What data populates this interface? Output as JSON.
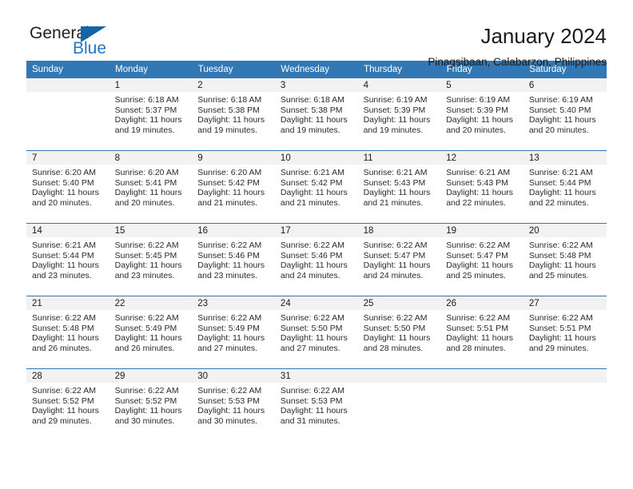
{
  "logo": {
    "word1": "General",
    "word2": "Blue",
    "triangle_color": "#1464aa",
    "blue_color": "#1e78c8"
  },
  "header": {
    "title": "January 2024",
    "subtitle": "Pinagsibaan, Calabarzon, Philippines"
  },
  "theme": {
    "header_bg": "#3278b4",
    "daynum_bg": "#f2f2f2",
    "grid_line": "#3278b4"
  },
  "weekdays": [
    "Sunday",
    "Monday",
    "Tuesday",
    "Wednesday",
    "Thursday",
    "Friday",
    "Saturday"
  ],
  "labels": {
    "sunrise_prefix": "Sunrise: ",
    "sunset_prefix": "Sunset: ",
    "daylight_prefix": "Daylight: "
  },
  "weeks": [
    [
      {
        "day": "",
        "blank": true
      },
      {
        "day": "1",
        "sunrise": "Sunrise: 6:18 AM",
        "sunset": "Sunset: 5:37 PM",
        "daylight1": "Daylight: 11 hours",
        "daylight2": "and 19 minutes."
      },
      {
        "day": "2",
        "sunrise": "Sunrise: 6:18 AM",
        "sunset": "Sunset: 5:38 PM",
        "daylight1": "Daylight: 11 hours",
        "daylight2": "and 19 minutes."
      },
      {
        "day": "3",
        "sunrise": "Sunrise: 6:18 AM",
        "sunset": "Sunset: 5:38 PM",
        "daylight1": "Daylight: 11 hours",
        "daylight2": "and 19 minutes."
      },
      {
        "day": "4",
        "sunrise": "Sunrise: 6:19 AM",
        "sunset": "Sunset: 5:39 PM",
        "daylight1": "Daylight: 11 hours",
        "daylight2": "and 19 minutes."
      },
      {
        "day": "5",
        "sunrise": "Sunrise: 6:19 AM",
        "sunset": "Sunset: 5:39 PM",
        "daylight1": "Daylight: 11 hours",
        "daylight2": "and 20 minutes."
      },
      {
        "day": "6",
        "sunrise": "Sunrise: 6:19 AM",
        "sunset": "Sunset: 5:40 PM",
        "daylight1": "Daylight: 11 hours",
        "daylight2": "and 20 minutes."
      }
    ],
    [
      {
        "day": "7",
        "sunrise": "Sunrise: 6:20 AM",
        "sunset": "Sunset: 5:40 PM",
        "daylight1": "Daylight: 11 hours",
        "daylight2": "and 20 minutes."
      },
      {
        "day": "8",
        "sunrise": "Sunrise: 6:20 AM",
        "sunset": "Sunset: 5:41 PM",
        "daylight1": "Daylight: 11 hours",
        "daylight2": "and 20 minutes."
      },
      {
        "day": "9",
        "sunrise": "Sunrise: 6:20 AM",
        "sunset": "Sunset: 5:42 PM",
        "daylight1": "Daylight: 11 hours",
        "daylight2": "and 21 minutes."
      },
      {
        "day": "10",
        "sunrise": "Sunrise: 6:21 AM",
        "sunset": "Sunset: 5:42 PM",
        "daylight1": "Daylight: 11 hours",
        "daylight2": "and 21 minutes."
      },
      {
        "day": "11",
        "sunrise": "Sunrise: 6:21 AM",
        "sunset": "Sunset: 5:43 PM",
        "daylight1": "Daylight: 11 hours",
        "daylight2": "and 21 minutes."
      },
      {
        "day": "12",
        "sunrise": "Sunrise: 6:21 AM",
        "sunset": "Sunset: 5:43 PM",
        "daylight1": "Daylight: 11 hours",
        "daylight2": "and 22 minutes."
      },
      {
        "day": "13",
        "sunrise": "Sunrise: 6:21 AM",
        "sunset": "Sunset: 5:44 PM",
        "daylight1": "Daylight: 11 hours",
        "daylight2": "and 22 minutes."
      }
    ],
    [
      {
        "day": "14",
        "sunrise": "Sunrise: 6:21 AM",
        "sunset": "Sunset: 5:44 PM",
        "daylight1": "Daylight: 11 hours",
        "daylight2": "and 23 minutes."
      },
      {
        "day": "15",
        "sunrise": "Sunrise: 6:22 AM",
        "sunset": "Sunset: 5:45 PM",
        "daylight1": "Daylight: 11 hours",
        "daylight2": "and 23 minutes."
      },
      {
        "day": "16",
        "sunrise": "Sunrise: 6:22 AM",
        "sunset": "Sunset: 5:46 PM",
        "daylight1": "Daylight: 11 hours",
        "daylight2": "and 23 minutes."
      },
      {
        "day": "17",
        "sunrise": "Sunrise: 6:22 AM",
        "sunset": "Sunset: 5:46 PM",
        "daylight1": "Daylight: 11 hours",
        "daylight2": "and 24 minutes."
      },
      {
        "day": "18",
        "sunrise": "Sunrise: 6:22 AM",
        "sunset": "Sunset: 5:47 PM",
        "daylight1": "Daylight: 11 hours",
        "daylight2": "and 24 minutes."
      },
      {
        "day": "19",
        "sunrise": "Sunrise: 6:22 AM",
        "sunset": "Sunset: 5:47 PM",
        "daylight1": "Daylight: 11 hours",
        "daylight2": "and 25 minutes."
      },
      {
        "day": "20",
        "sunrise": "Sunrise: 6:22 AM",
        "sunset": "Sunset: 5:48 PM",
        "daylight1": "Daylight: 11 hours",
        "daylight2": "and 25 minutes."
      }
    ],
    [
      {
        "day": "21",
        "sunrise": "Sunrise: 6:22 AM",
        "sunset": "Sunset: 5:48 PM",
        "daylight1": "Daylight: 11 hours",
        "daylight2": "and 26 minutes."
      },
      {
        "day": "22",
        "sunrise": "Sunrise: 6:22 AM",
        "sunset": "Sunset: 5:49 PM",
        "daylight1": "Daylight: 11 hours",
        "daylight2": "and 26 minutes."
      },
      {
        "day": "23",
        "sunrise": "Sunrise: 6:22 AM",
        "sunset": "Sunset: 5:49 PM",
        "daylight1": "Daylight: 11 hours",
        "daylight2": "and 27 minutes."
      },
      {
        "day": "24",
        "sunrise": "Sunrise: 6:22 AM",
        "sunset": "Sunset: 5:50 PM",
        "daylight1": "Daylight: 11 hours",
        "daylight2": "and 27 minutes."
      },
      {
        "day": "25",
        "sunrise": "Sunrise: 6:22 AM",
        "sunset": "Sunset: 5:50 PM",
        "daylight1": "Daylight: 11 hours",
        "daylight2": "and 28 minutes."
      },
      {
        "day": "26",
        "sunrise": "Sunrise: 6:22 AM",
        "sunset": "Sunset: 5:51 PM",
        "daylight1": "Daylight: 11 hours",
        "daylight2": "and 28 minutes."
      },
      {
        "day": "27",
        "sunrise": "Sunrise: 6:22 AM",
        "sunset": "Sunset: 5:51 PM",
        "daylight1": "Daylight: 11 hours",
        "daylight2": "and 29 minutes."
      }
    ],
    [
      {
        "day": "28",
        "sunrise": "Sunrise: 6:22 AM",
        "sunset": "Sunset: 5:52 PM",
        "daylight1": "Daylight: 11 hours",
        "daylight2": "and 29 minutes."
      },
      {
        "day": "29",
        "sunrise": "Sunrise: 6:22 AM",
        "sunset": "Sunset: 5:52 PM",
        "daylight1": "Daylight: 11 hours",
        "daylight2": "and 30 minutes."
      },
      {
        "day": "30",
        "sunrise": "Sunrise: 6:22 AM",
        "sunset": "Sunset: 5:53 PM",
        "daylight1": "Daylight: 11 hours",
        "daylight2": "and 30 minutes."
      },
      {
        "day": "31",
        "sunrise": "Sunrise: 6:22 AM",
        "sunset": "Sunset: 5:53 PM",
        "daylight1": "Daylight: 11 hours",
        "daylight2": "and 31 minutes."
      },
      {
        "day": "",
        "blank": true
      },
      {
        "day": "",
        "blank": true
      },
      {
        "day": "",
        "blank": true
      }
    ]
  ]
}
